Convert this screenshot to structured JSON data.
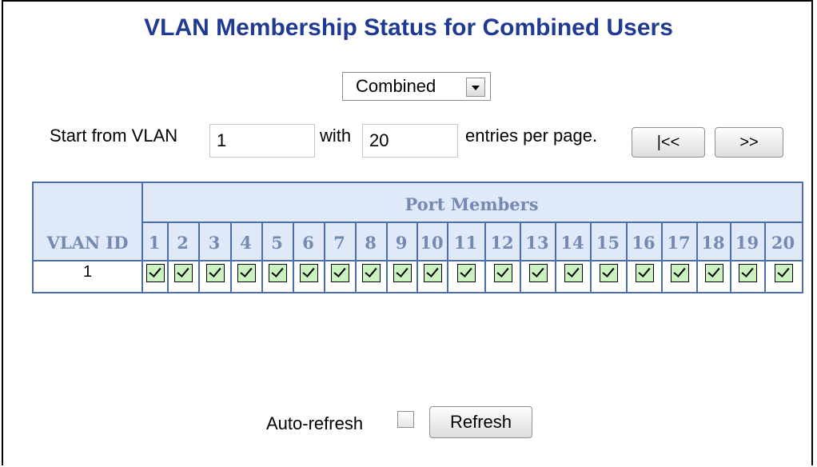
{
  "title": "VLAN Membership Status for Combined Users",
  "user_select": {
    "selected": "Combined"
  },
  "nav": {
    "start_label": "Start from VLAN",
    "start_value": "1",
    "with_label": "with",
    "entries_value": "20",
    "entries_label": "entries per page.",
    "first_button": "|<<",
    "next_button": ">>"
  },
  "table": {
    "group_header": "Port Members",
    "id_header": "VLAN ID",
    "ports": [
      "1",
      "2",
      "3",
      "4",
      "5",
      "6",
      "7",
      "8",
      "9",
      "10",
      "11",
      "12",
      "13",
      "14",
      "15",
      "16",
      "17",
      "18",
      "19",
      "20"
    ],
    "rows": [
      {
        "vlan_id": "1",
        "members": [
          true,
          true,
          true,
          true,
          true,
          true,
          true,
          true,
          true,
          true,
          true,
          true,
          true,
          true,
          true,
          true,
          true,
          true,
          true,
          true
        ]
      }
    ]
  },
  "footer": {
    "auto_refresh_label": "Auto-refresh",
    "auto_refresh_checked": false,
    "refresh_button": "Refresh"
  },
  "colors": {
    "title": "#1f3a93",
    "table_border": "#4a6fb0",
    "header_bg": "#dfe9f7",
    "header_text": "#7589b3",
    "member_fill": "#c9f2c0"
  }
}
